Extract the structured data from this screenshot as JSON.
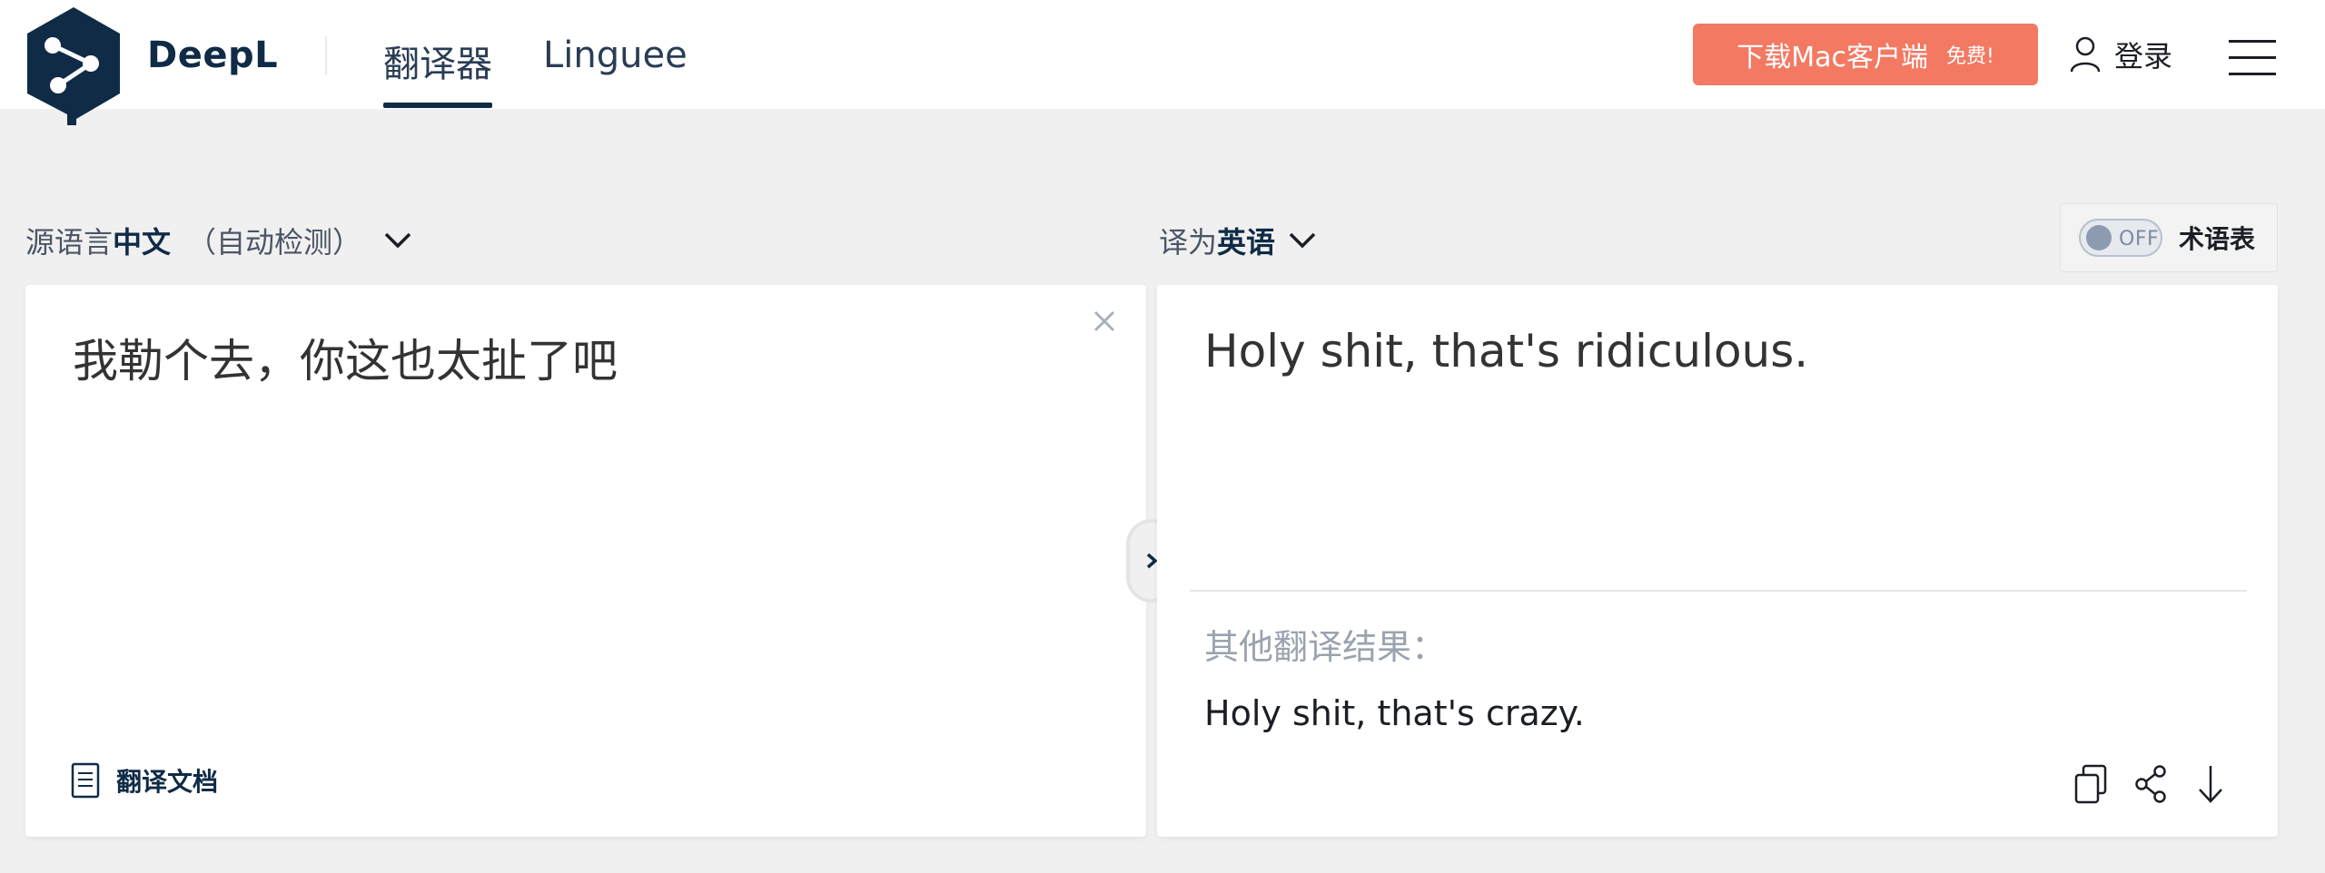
{
  "header": {
    "brand": "DeepL",
    "tabs": [
      "翻译器",
      "Linguee"
    ],
    "download_label": "下载Mac客户端",
    "download_badge": "免费!",
    "login_label": "登录",
    "accent_color": "#f37963",
    "brand_color": "#0f2b46"
  },
  "source": {
    "lang_prefix": "源语言",
    "lang_name": "中文",
    "auto_detect": "（自动检测）",
    "text": "我勒个去，你这也太扯了吧",
    "document_label": "翻译文档"
  },
  "target": {
    "lang_prefix": "译为",
    "lang_name": "英语",
    "text": "Holy shit, that's ridiculous.",
    "alternatives_label": "其他翻译结果：",
    "alternatives": [
      "Holy shit, that's crazy."
    ]
  },
  "glossary": {
    "toggle_state": "OFF",
    "label": "术语表"
  },
  "icons": {
    "logo": "deepl-logo",
    "clear": "close-icon",
    "document": "document-icon",
    "swap": "chevron-right-icon",
    "copy": "copy-icon",
    "share": "share-icon",
    "download": "arrow-down-icon",
    "user": "user-icon",
    "menu": "hamburger-icon"
  }
}
